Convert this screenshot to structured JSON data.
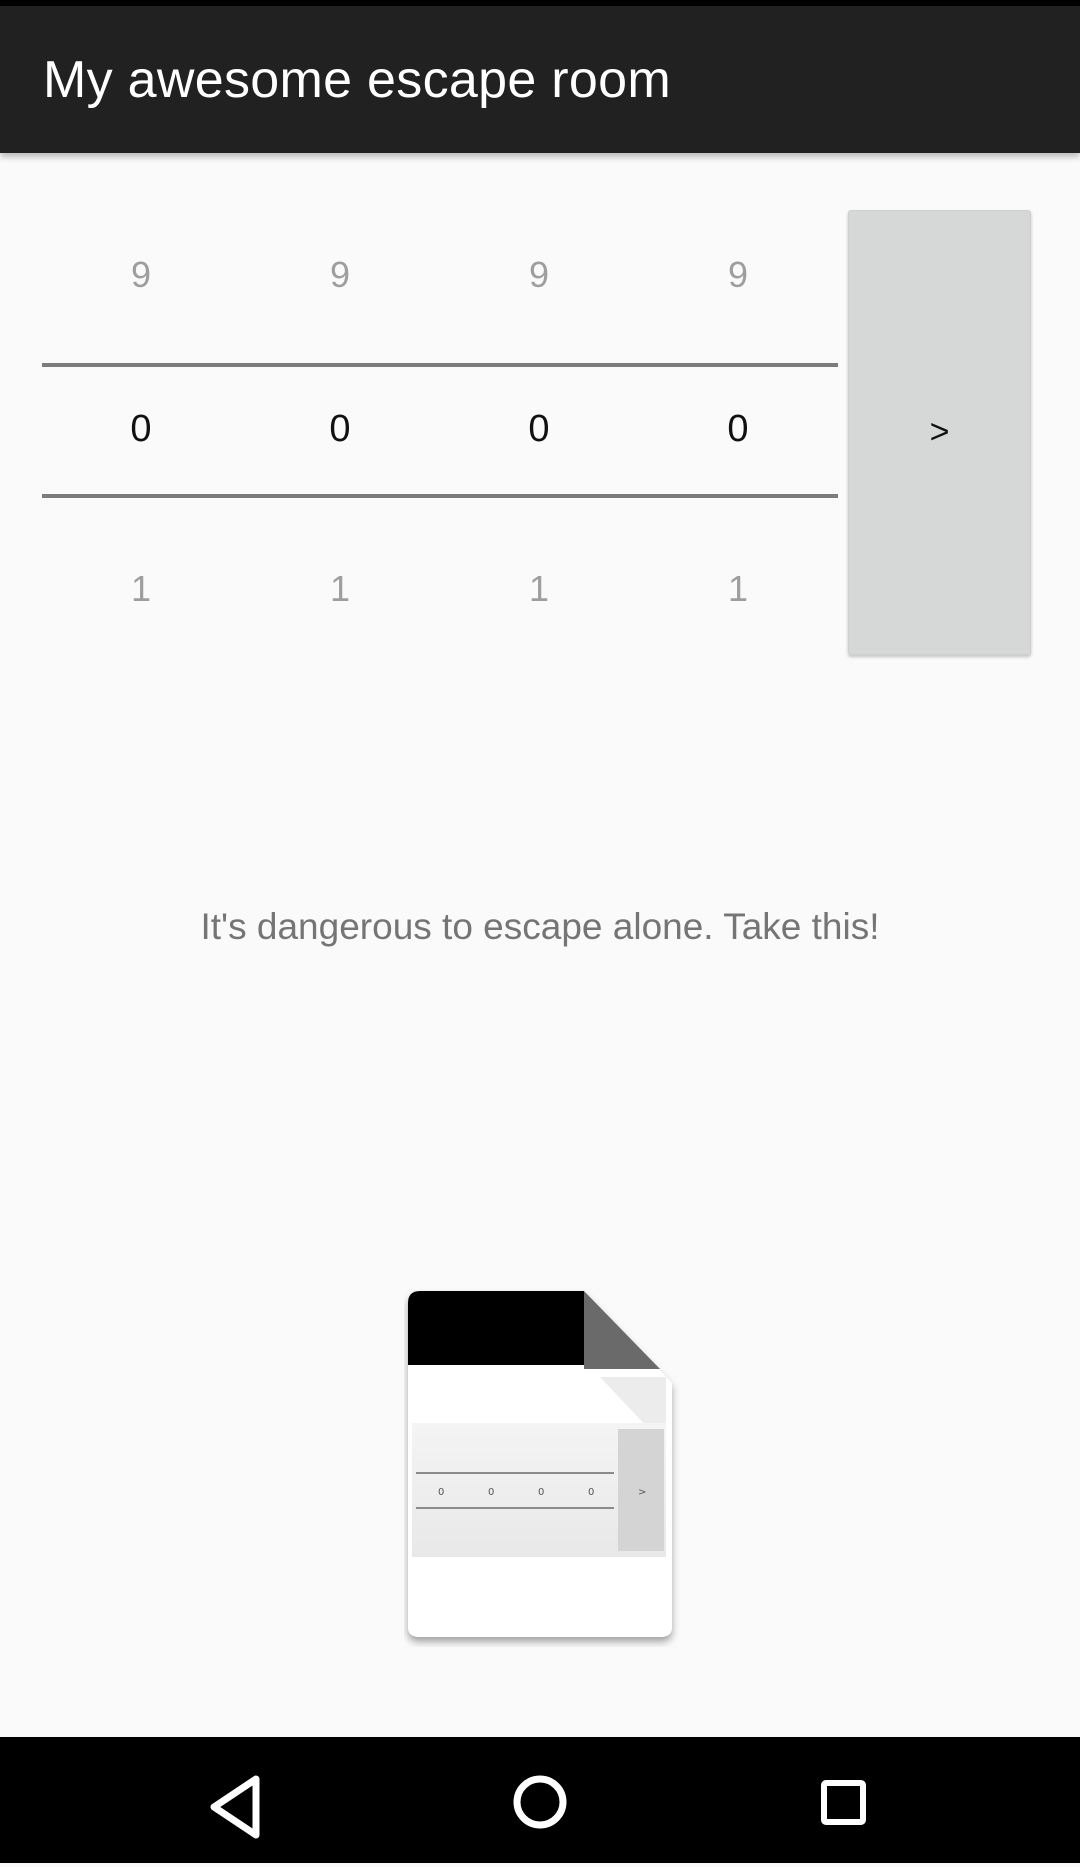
{
  "app_bar": {
    "title": "My awesome escape room"
  },
  "lock": {
    "wheels": [
      {
        "prev": "9",
        "value": "0",
        "next": "1"
      },
      {
        "prev": "9",
        "value": "0",
        "next": "1"
      },
      {
        "prev": "9",
        "value": "0",
        "next": "1"
      },
      {
        "prev": "9",
        "value": "0",
        "next": "1"
      }
    ],
    "submit_label": ">"
  },
  "hint_text": "It's dangerous to escape alone. Take this!",
  "item": {
    "icon": "document-icon"
  },
  "nav": {
    "back_icon": "back-icon",
    "home_icon": "home-icon",
    "recents_icon": "recents-icon"
  }
}
